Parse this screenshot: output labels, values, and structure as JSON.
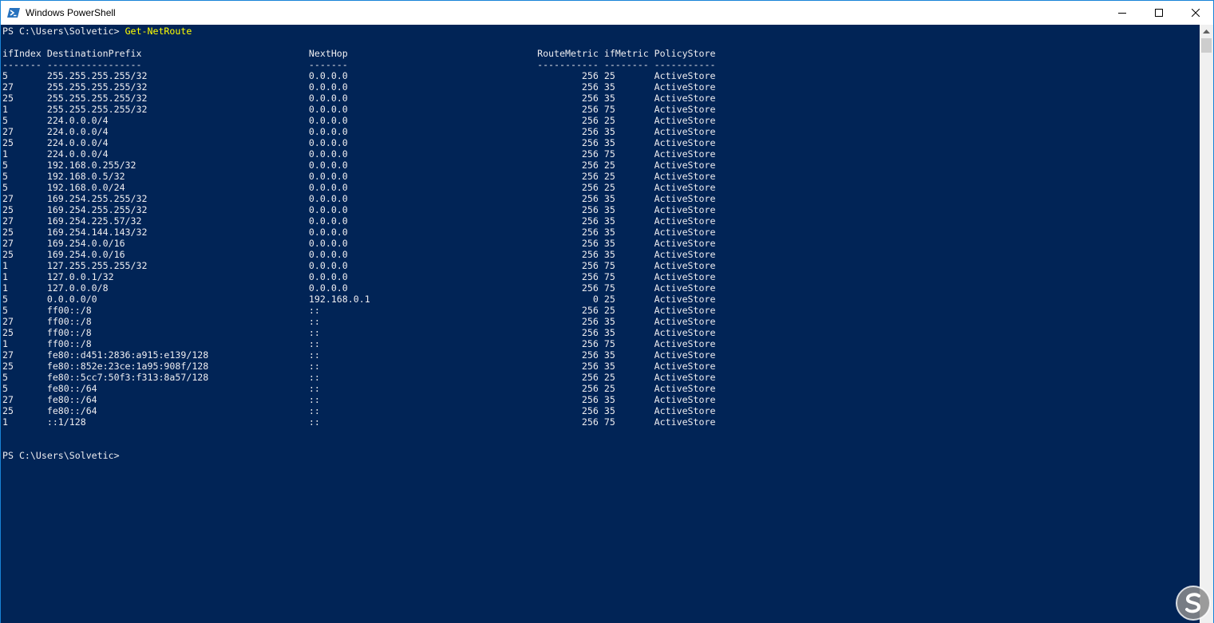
{
  "window": {
    "title": "Windows PowerShell",
    "icon": "powershell-icon",
    "controls": [
      "minimize-icon",
      "maximize-icon",
      "close-icon"
    ]
  },
  "console": {
    "prompt": "PS C:\\Users\\Solvetic> ",
    "command": "Get-NetRoute",
    "header": "ifIndex DestinationPrefix                              NextHop                                  RouteMetric ifMetric PolicyStore",
    "separator": "------- -----------------                              -------                                  ----------- -------- -----------",
    "rows": [
      "5       255.255.255.255/32                             0.0.0.0                                          256 25       ActiveStore",
      "27      255.255.255.255/32                             0.0.0.0                                          256 35       ActiveStore",
      "25      255.255.255.255/32                             0.0.0.0                                          256 35       ActiveStore",
      "1       255.255.255.255/32                             0.0.0.0                                          256 75       ActiveStore",
      "5       224.0.0.0/4                                    0.0.0.0                                          256 25       ActiveStore",
      "27      224.0.0.0/4                                    0.0.0.0                                          256 35       ActiveStore",
      "25      224.0.0.0/4                                    0.0.0.0                                          256 35       ActiveStore",
      "1       224.0.0.0/4                                    0.0.0.0                                          256 75       ActiveStore",
      "5       192.168.0.255/32                               0.0.0.0                                          256 25       ActiveStore",
      "5       192.168.0.5/32                                 0.0.0.0                                          256 25       ActiveStore",
      "5       192.168.0.0/24                                 0.0.0.0                                          256 25       ActiveStore",
      "27      169.254.255.255/32                             0.0.0.0                                          256 35       ActiveStore",
      "25      169.254.255.255/32                             0.0.0.0                                          256 35       ActiveStore",
      "27      169.254.225.57/32                              0.0.0.0                                          256 35       ActiveStore",
      "25      169.254.144.143/32                             0.0.0.0                                          256 35       ActiveStore",
      "27      169.254.0.0/16                                 0.0.0.0                                          256 35       ActiveStore",
      "25      169.254.0.0/16                                 0.0.0.0                                          256 35       ActiveStore",
      "1       127.255.255.255/32                             0.0.0.0                                          256 75       ActiveStore",
      "1       127.0.0.1/32                                   0.0.0.0                                          256 75       ActiveStore",
      "1       127.0.0.0/8                                    0.0.0.0                                          256 75       ActiveStore",
      "5       0.0.0.0/0                                      192.168.0.1                                        0 25       ActiveStore",
      "5       ff00::/8                                       ::                                               256 25       ActiveStore",
      "27      ff00::/8                                       ::                                               256 35       ActiveStore",
      "25      ff00::/8                                       ::                                               256 35       ActiveStore",
      "1       ff00::/8                                       ::                                               256 75       ActiveStore",
      "27      fe80::d451:2836:a915:e139/128                  ::                                               256 35       ActiveStore",
      "25      fe80::852e:23ce:1a95:908f/128                  ::                                               256 35       ActiveStore",
      "5       fe80::5cc7:50f3:f313:8a57/128                  ::                                               256 25       ActiveStore",
      "5       fe80::/64                                      ::                                               256 25       ActiveStore",
      "27      fe80::/64                                      ::                                               256 35       ActiveStore",
      "25      fe80::/64                                      ::                                               256 35       ActiveStore",
      "1       ::1/128                                        ::                                               256 75       ActiveStore"
    ],
    "final_prompt": "PS C:\\Users\\Solvetic>"
  },
  "scrollbar": {
    "up_icon": "scroll-up-arrow-icon"
  },
  "watermark": {
    "icon": "solvetic-logo-icon"
  }
}
